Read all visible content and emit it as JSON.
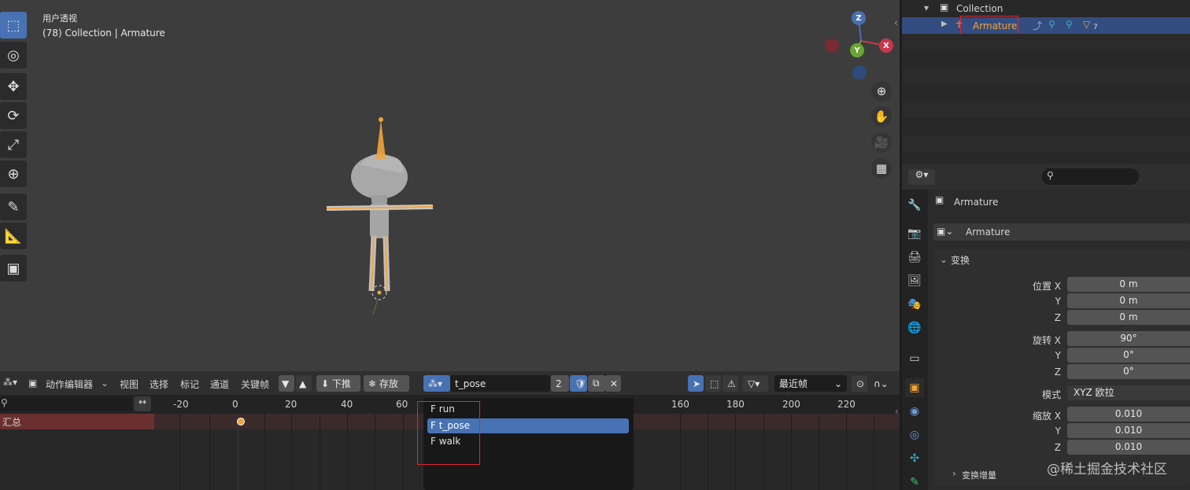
{
  "viewport": {
    "view_name": "用户透视",
    "object_info": "(78) Collection | Armature",
    "gizmo": {
      "z": "Z",
      "x": "X",
      "y": "Y"
    }
  },
  "tools": [
    "select-box-icon",
    "cursor-icon",
    "move-icon",
    "rotate-icon",
    "scale-icon",
    "transform-icon",
    "annotate-icon",
    "measure-icon",
    "add-cube-icon"
  ],
  "action_editor": {
    "editor_type": "动作编辑器",
    "menus": [
      "视图",
      "选择",
      "标记",
      "通道",
      "关键帧"
    ],
    "push_down": "下推",
    "stash": "存放",
    "action_name": "t_pose",
    "users": "2",
    "snap_mode": "最近帧",
    "search_value": "",
    "summary_label": "汇总",
    "ruler_ticks": [
      "-20",
      "0",
      "20",
      "40",
      "60",
      "160",
      "180",
      "200",
      "220"
    ],
    "action_menu": [
      {
        "label": "F run",
        "selected": false
      },
      {
        "label": "F t_pose",
        "selected": true
      },
      {
        "label": "F walk",
        "selected": false
      }
    ]
  },
  "outliner": {
    "collection": "Collection",
    "armature": "Armature",
    "extra_count": "7"
  },
  "properties": {
    "object_name": "Armature",
    "datablock_name": "Armature",
    "section_transform": "变换",
    "location_label": "位置 X",
    "y_label": "Y",
    "z_label": "Z",
    "location": [
      "0 m",
      "0 m",
      "0 m"
    ],
    "rotation_label": "旋转 X",
    "rotation": [
      "90°",
      "0°",
      "0°"
    ],
    "mode_label": "模式",
    "mode_value": "XYZ 欧拉",
    "scale_label": "缩放 X",
    "scale": [
      "0.010",
      "0.010",
      "0.010"
    ],
    "delta_transform": "变换增量"
  },
  "watermark": "@稀土掘金技术社区",
  "colors": {
    "accent": "#4772b3",
    "highlight_red": "#e0262e",
    "armature_orange": "#f2a33a"
  }
}
